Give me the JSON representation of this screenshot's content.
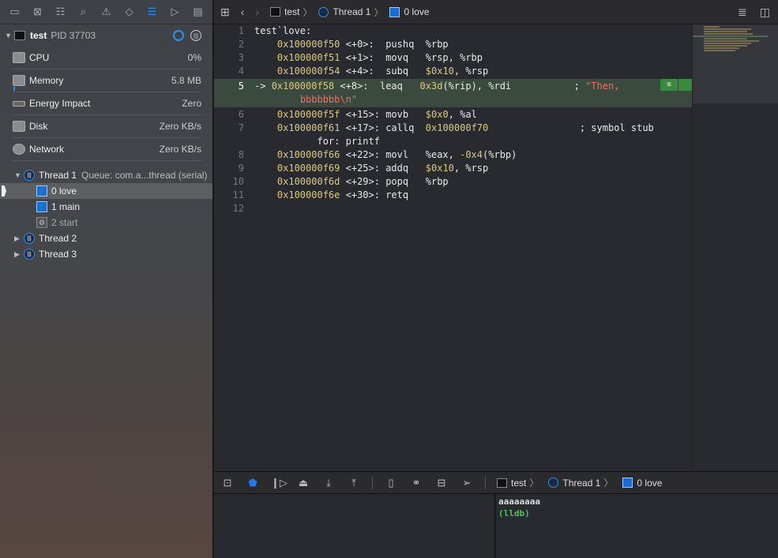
{
  "navigator": {
    "icons": [
      "folder-icon",
      "source-control-icon",
      "hierarchy-icon",
      "search-icon",
      "warning-icon",
      "breakpoint-test-icon",
      "debug-navigator-icon",
      "breakpoint-icon",
      "report-icon"
    ],
    "process": {
      "name": "test",
      "pid": "PID 37703"
    },
    "gauges": [
      {
        "label": "CPU",
        "value": "0%"
      },
      {
        "label": "Memory",
        "value": "5.8 MB",
        "fraction": 0.01
      },
      {
        "label": "Energy Impact",
        "value": "Zero"
      },
      {
        "label": "Disk",
        "value": "Zero KB/s"
      },
      {
        "label": "Network",
        "value": "Zero KB/s"
      }
    ],
    "thread1": {
      "label": "Thread 1",
      "queue": "Queue: com.a...thread (serial)"
    },
    "frames": [
      {
        "label": "0 love"
      },
      {
        "label": "1 main"
      },
      {
        "label": "2 start"
      }
    ],
    "threads": [
      {
        "label": "Thread 2"
      },
      {
        "label": "Thread 3"
      }
    ]
  },
  "jumpbar": {
    "crumbs": [
      "test",
      "Thread 1",
      "0 love"
    ]
  },
  "code": {
    "current_line": 5,
    "lines": [
      {
        "n": "1",
        "segs": [
          [
            "",
            "test`love:"
          ]
        ]
      },
      {
        "n": "2",
        "segs": [
          [
            "",
            "    "
          ],
          [
            "addr",
            "0x100000f50"
          ],
          [
            "",
            " <+0>:  pushq  %rbp"
          ]
        ]
      },
      {
        "n": "3",
        "segs": [
          [
            "",
            "    "
          ],
          [
            "addr",
            "0x100000f51"
          ],
          [
            "",
            " <+1>:  movq   %rsp, %rbp"
          ]
        ]
      },
      {
        "n": "4",
        "segs": [
          [
            "",
            "    "
          ],
          [
            "addr",
            "0x100000f54"
          ],
          [
            "",
            " <+4>:  subq   "
          ],
          [
            "num",
            "$0x10"
          ],
          [
            "",
            ", %rsp"
          ]
        ]
      },
      {
        "n": "5",
        "segs": [
          [
            "",
            "-> "
          ],
          [
            "addr",
            "0x100000f58"
          ],
          [
            "",
            " <+8>:  leaq   "
          ],
          [
            "num",
            "0x3d"
          ],
          [
            "",
            "(%rip), %rdi           ; "
          ],
          [
            "str",
            "\"Then,"
          ]
        ],
        "cont": [
          [
            "",
            "    "
          ],
          [
            "str",
            "bbbbbbb\\n\""
          ]
        ]
      },
      {
        "n": "6",
        "segs": [
          [
            "",
            "    "
          ],
          [
            "addr",
            "0x100000f5f"
          ],
          [
            "",
            " <+15>: movb   "
          ],
          [
            "num",
            "$0x0"
          ],
          [
            "",
            ", %al"
          ]
        ]
      },
      {
        "n": "7",
        "segs": [
          [
            "",
            "    "
          ],
          [
            "addr",
            "0x100000f61"
          ],
          [
            "",
            " <+17>: callq  "
          ],
          [
            "num",
            "0x100000f70"
          ],
          [
            "",
            "                ; symbol stub"
          ]
        ],
        "cont": [
          [
            "",
            "       for: printf"
          ]
        ]
      },
      {
        "n": "8",
        "segs": [
          [
            "",
            "    "
          ],
          [
            "addr",
            "0x100000f66"
          ],
          [
            "",
            " <+22>: movl   %eax, "
          ],
          [
            "num",
            "-0x4"
          ],
          [
            "",
            "(%rbp)"
          ]
        ]
      },
      {
        "n": "9",
        "segs": [
          [
            "",
            "    "
          ],
          [
            "addr",
            "0x100000f69"
          ],
          [
            "",
            " <+25>: addq   "
          ],
          [
            "num",
            "$0x10"
          ],
          [
            "",
            ", %rsp"
          ]
        ]
      },
      {
        "n": "10",
        "segs": [
          [
            "",
            "    "
          ],
          [
            "addr",
            "0x100000f6d"
          ],
          [
            "",
            " <+29>: popq   %rbp"
          ]
        ]
      },
      {
        "n": "11",
        "segs": [
          [
            "",
            "    "
          ],
          [
            "addr",
            "0x100000f6e"
          ],
          [
            "",
            " <+30>: retq"
          ]
        ]
      },
      {
        "n": "12",
        "segs": []
      }
    ]
  },
  "debugbar": {
    "crumbs": [
      "test",
      "Thread 1",
      "0 love"
    ]
  },
  "console": {
    "output": "aaaaaaaa",
    "prompt": "(lldb)"
  },
  "colors": {
    "accent": "#2c8ff0",
    "current_line": "#3a4a3e",
    "address": "#d9c97c",
    "string": "#fc6a5d",
    "prompt": "#4cc35a"
  }
}
